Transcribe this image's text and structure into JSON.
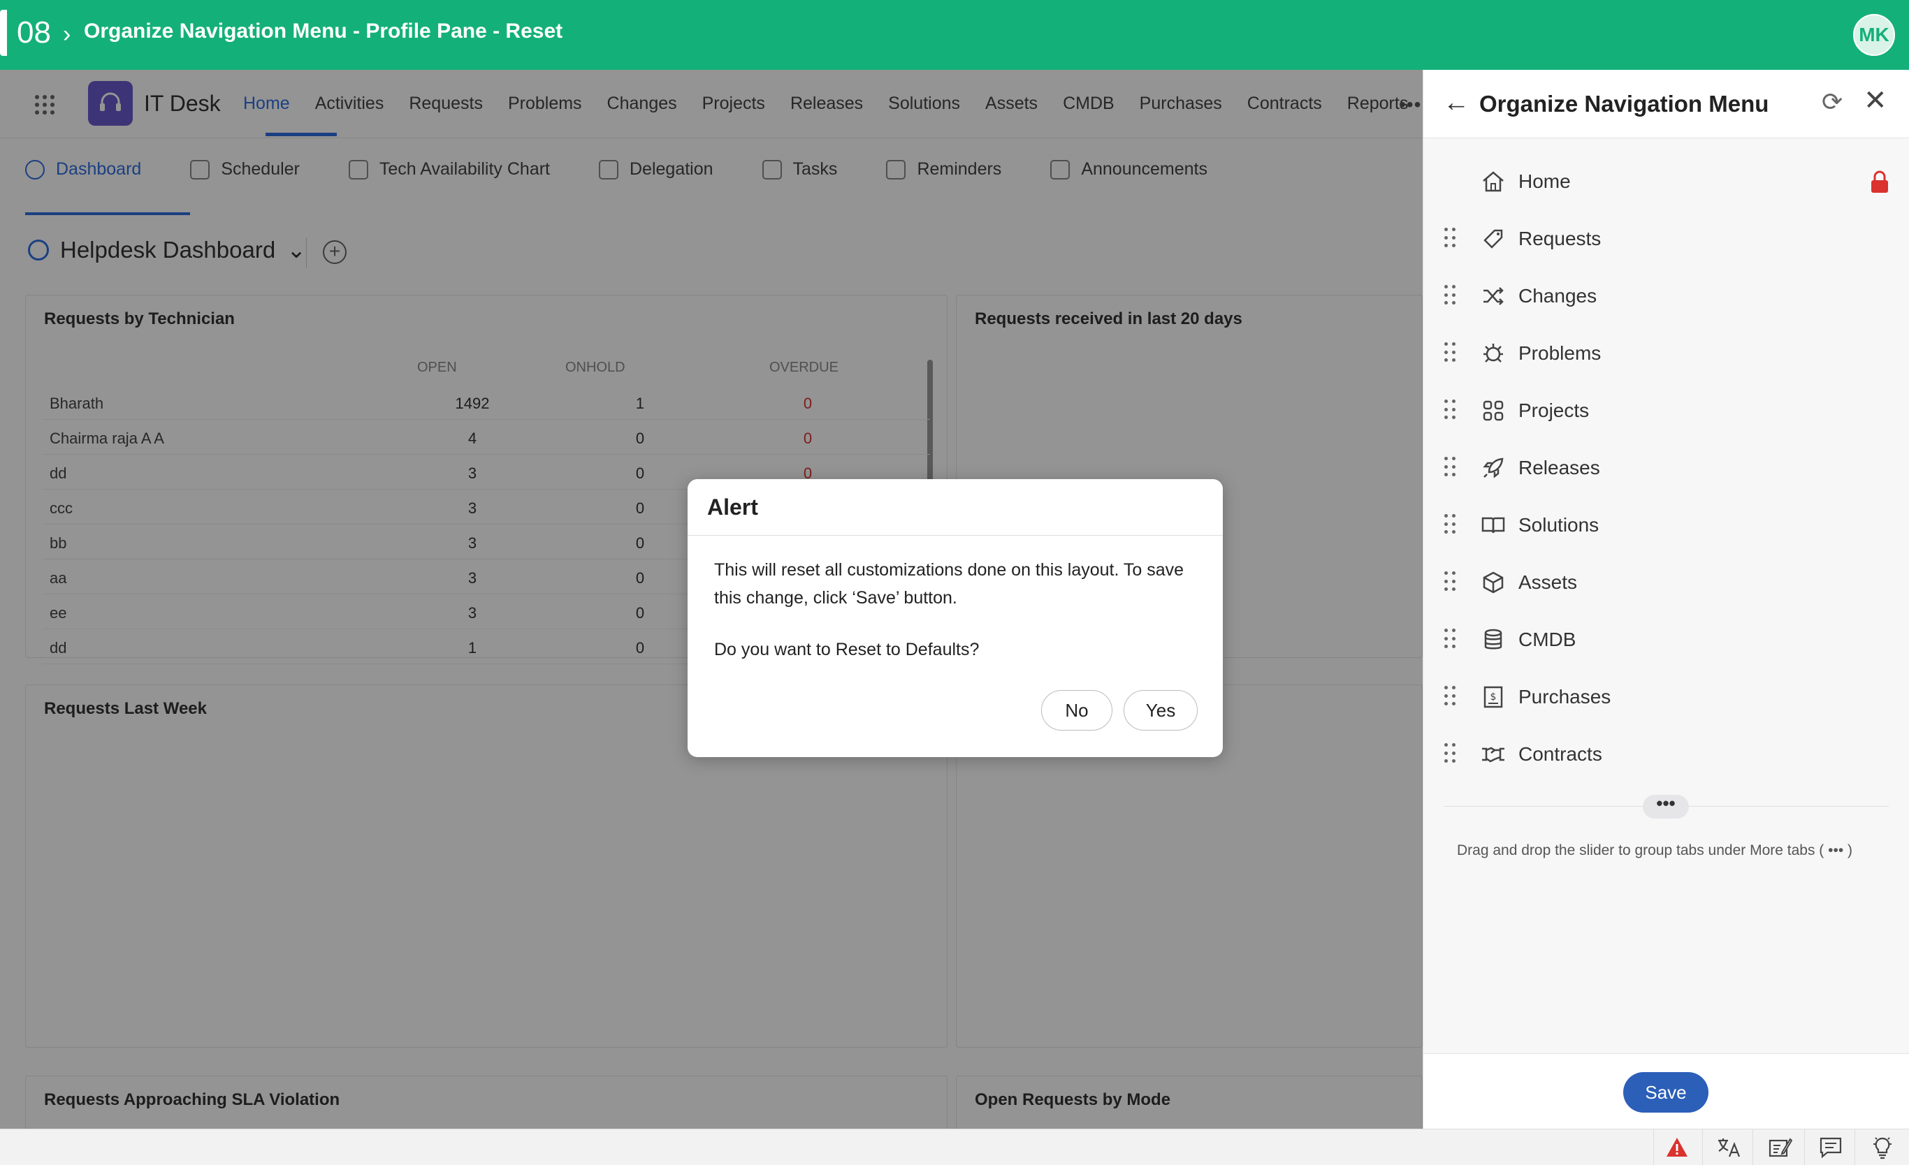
{
  "titlebar": {
    "step": "08",
    "title": "Organize Navigation Menu - Profile Pane - Reset",
    "avatar_initials": "MK"
  },
  "app": {
    "name": "IT Desk",
    "nav_tabs": [
      "Home",
      "Activities",
      "Requests",
      "Problems",
      "Changes",
      "Projects",
      "Releases",
      "Solutions",
      "Assets",
      "CMDB",
      "Purchases",
      "Contracts",
      "Reports"
    ],
    "active_tab": "Home",
    "more": "•••",
    "subtabs": [
      "Dashboard",
      "Scheduler",
      "Tech Availability Chart",
      "Delegation",
      "Tasks",
      "Reminders",
      "Announcements"
    ],
    "active_subtab": "Dashboard",
    "dashboard_title": "Helpdesk Dashboard"
  },
  "widgets": {
    "technician": {
      "title": "Requests by Technician",
      "headers": [
        "OPEN",
        "ONHOLD",
        "OVERDUE"
      ],
      "rows": [
        {
          "name": "Bharath",
          "open": "1492",
          "onhold": "1",
          "overdue": "0"
        },
        {
          "name": "Chairma raja A A",
          "open": "4",
          "onhold": "0",
          "overdue": "0"
        },
        {
          "name": "dd",
          "open": "3",
          "onhold": "0",
          "overdue": "0"
        },
        {
          "name": "ccc",
          "open": "3",
          "onhold": "0",
          "overdue": ""
        },
        {
          "name": "bb",
          "open": "3",
          "onhold": "0",
          "overdue": ""
        },
        {
          "name": "aa",
          "open": "3",
          "onhold": "0",
          "overdue": ""
        },
        {
          "name": "ee",
          "open": "3",
          "onhold": "0",
          "overdue": ""
        },
        {
          "name": "dd",
          "open": "1",
          "onhold": "0",
          "overdue": ""
        }
      ]
    },
    "last20": {
      "title": "Requests received in last 20 days"
    },
    "lastweek": {
      "title": "Requests Last Week"
    },
    "sla": {
      "title": "Requests Approaching SLA Violation"
    },
    "mode": {
      "title": "Open Requests by Mode"
    }
  },
  "alert": {
    "title": "Alert",
    "message": "This will reset all customizations done on this layout. To save this change, click ‘Save’ button.",
    "question": "Do you want to Reset to Defaults?",
    "no_label": "No",
    "yes_label": "Yes"
  },
  "panel": {
    "title": "Organize Navigation Menu",
    "items": [
      {
        "label": "Home",
        "icon": "home-icon",
        "locked": true
      },
      {
        "label": "Requests",
        "icon": "tag-icon"
      },
      {
        "label": "Changes",
        "icon": "shuffle-icon"
      },
      {
        "label": "Problems",
        "icon": "bug-icon"
      },
      {
        "label": "Projects",
        "icon": "puzzle-icon"
      },
      {
        "label": "Releases",
        "icon": "rocket-icon"
      },
      {
        "label": "Solutions",
        "icon": "book-icon"
      },
      {
        "label": "Assets",
        "icon": "cube-icon"
      },
      {
        "label": "CMDB",
        "icon": "database-icon"
      },
      {
        "label": "Purchases",
        "icon": "receipt-icon"
      },
      {
        "label": "Contracts",
        "icon": "handshake-icon"
      }
    ],
    "more_pill": "•••",
    "hint": "Drag and drop the slider to group tabs under More tabs (  •••  )",
    "save_label": "Save"
  },
  "colors": {
    "brand_green": "#14b07a",
    "accent_blue": "#2f6fde",
    "save_blue": "#2b5fb8",
    "lock_red": "#d9322f"
  }
}
